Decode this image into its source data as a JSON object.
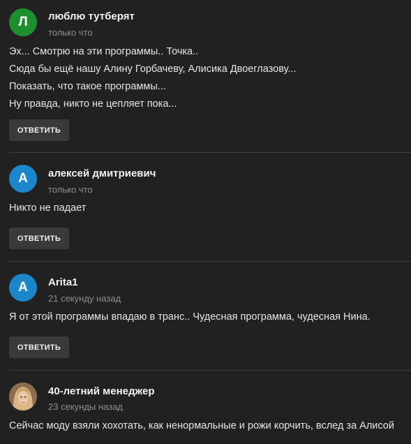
{
  "comments": [
    {
      "avatar_letter": "Л",
      "avatar_color": "#1e8f2e",
      "author": "люблю тутберят",
      "time": "только что",
      "lines": [
        "Эх... Смотрю на эти программы.. Точка..",
        "Сюда бы ещё нашу Алину Горбачеву, Алисика Двоеглазову...",
        "Показать, что такое программы...",
        "Ну правда, никто не цепляет пока..."
      ],
      "reply_label": "ОТВЕТИТЬ"
    },
    {
      "avatar_letter": "А",
      "avatar_color": "#1b86c9",
      "author": "алексей дмитриевич",
      "time": "только что",
      "lines": [
        "Никто не падает"
      ],
      "reply_label": "ОТВЕТИТЬ"
    },
    {
      "avatar_letter": "А",
      "avatar_color": "#1b86c9",
      "author": "Arita1",
      "time": "21 секунду назад",
      "lines": [
        "Я от этой программы впадаю в транс.. Чудесная программа, чудесная Нина."
      ],
      "reply_label": "ОТВЕТИТЬ"
    },
    {
      "avatar_letter": "",
      "avatar_color": "#b8956a",
      "author": "40-летний менеджер",
      "time": "23 секунды назад",
      "lines": [
        "Сейчас моду взяли хохотать, как ненормальные и рожи корчить, вслед за Алисой"
      ]
    }
  ]
}
